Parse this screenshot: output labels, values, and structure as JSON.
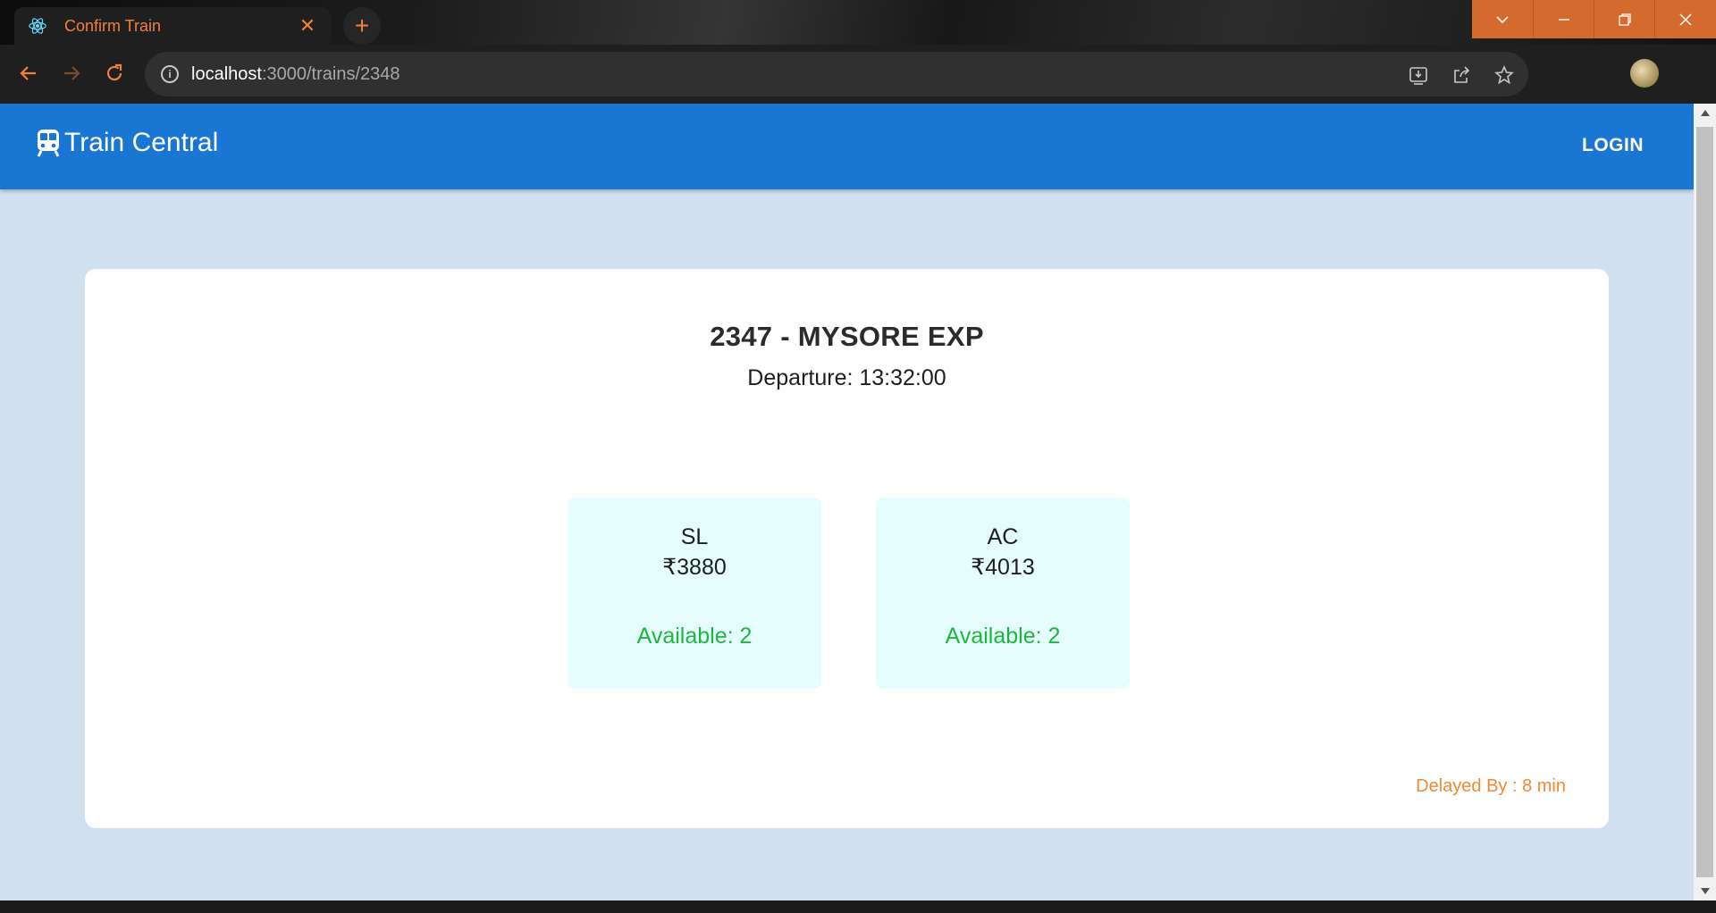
{
  "browser": {
    "tab_title": "Confirm Train",
    "url_host": "localhost",
    "url_rest": ":3000/trains/2348",
    "accent_color": "#f0803c"
  },
  "app": {
    "brand_name": "Train Central",
    "login_label": "LOGIN",
    "appbar_color": "#1976d2"
  },
  "train": {
    "title": "2347 - MYSORE EXP",
    "departure": "Departure: 13:32:00",
    "classes": [
      {
        "name": "SL",
        "price": "₹3880",
        "availability": "Available: 2"
      },
      {
        "name": "AC",
        "price": "₹4013",
        "availability": "Available: 2"
      }
    ],
    "delay": "Delayed By : 8 min"
  }
}
